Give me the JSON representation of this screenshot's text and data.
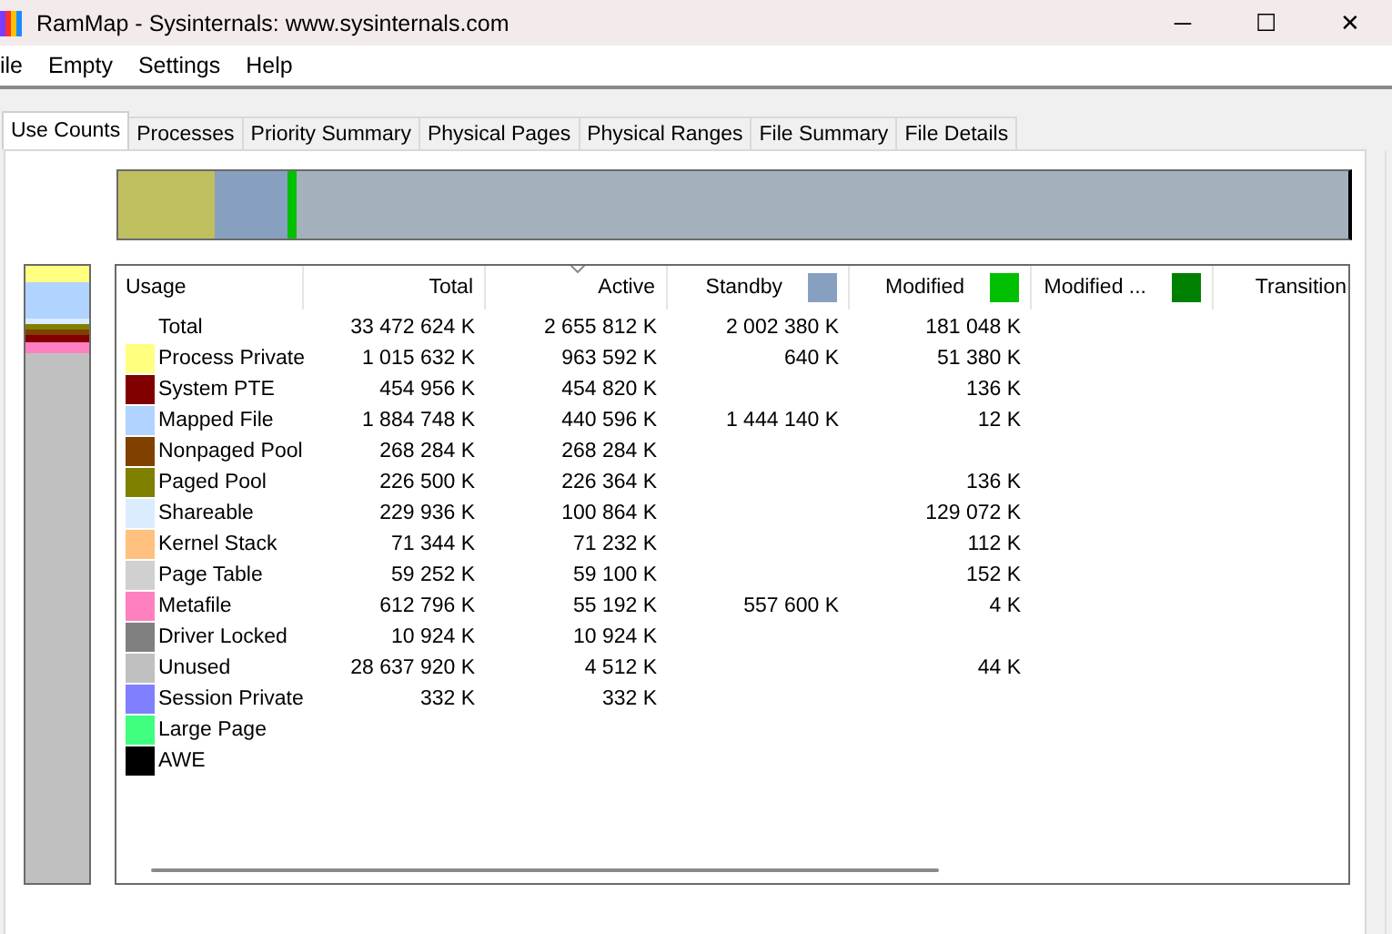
{
  "window": {
    "title": "RamMap - Sysinternals: www.sysinternals.com",
    "controls": [
      "─",
      "☐",
      "✕"
    ]
  },
  "menu": [
    "ile",
    "Empty",
    "Settings",
    "Help"
  ],
  "tabs": [
    {
      "label": "Use Counts",
      "selected": true
    },
    {
      "label": "Processes",
      "selected": false
    },
    {
      "label": "Priority Summary",
      "selected": false
    },
    {
      "label": "Physical Pages",
      "selected": false
    },
    {
      "label": "Physical Ranges",
      "selected": false
    },
    {
      "label": "File Summary",
      "selected": false
    },
    {
      "label": "File Details",
      "selected": false
    }
  ],
  "table": {
    "columns": [
      {
        "label": "Usage",
        "sorted": false
      },
      {
        "label": "Total",
        "sorted": false
      },
      {
        "label": "Active",
        "sorted": true
      },
      {
        "label": "Standby",
        "color": "#87a0c0",
        "sorted": false
      },
      {
        "label": "Modified",
        "color": "#00c000",
        "sorted": false
      },
      {
        "label": "Modified ...",
        "color": "#008000",
        "sorted": false
      },
      {
        "label": "Transition",
        "sorted": false
      }
    ],
    "rows": [
      {
        "cells": [
          "Total",
          "33 472 624 K",
          "2 655 812 K",
          "2 002 380 K",
          "181 048 K"
        ]
      },
      {
        "color": "#ffff80",
        "cells": [
          "Process Private",
          "1 015 632 K",
          "963 592 K",
          "640 K",
          "51 380 K"
        ]
      },
      {
        "color": "#800000",
        "cells": [
          "System PTE",
          "454 956 K",
          "454 820 K",
          "",
          "136 K"
        ]
      },
      {
        "color": "#b0d4ff",
        "cells": [
          "Mapped File",
          "1 884 748 K",
          "440 596 K",
          "1 444 140 K",
          "12 K"
        ]
      },
      {
        "color": "#804000",
        "cells": [
          "Nonpaged Pool",
          "268 284 K",
          "268 284 K"
        ]
      },
      {
        "color": "#808000",
        "cells": [
          "Paged Pool",
          "226 500 K",
          "226 364 K",
          "",
          "136 K"
        ]
      },
      {
        "color": "#dcecff",
        "cells": [
          "Shareable",
          "229 936 K",
          "100 864 K",
          "",
          "129 072 K"
        ]
      },
      {
        "color": "#ffc080",
        "cells": [
          "Kernel Stack",
          "71 344 K",
          "71 232 K",
          "",
          "112 K"
        ]
      },
      {
        "color": "#d0d0d0",
        "cells": [
          "Page Table",
          "59 252 K",
          "59 100 K",
          "",
          "152 K"
        ]
      },
      {
        "color": "#ff80c0",
        "cells": [
          "Metafile",
          "612 796 K",
          "55 192 K",
          "557 600 K",
          "4 K"
        ]
      },
      {
        "color": "#808080",
        "cells": [
          "Driver Locked",
          "10 924 K",
          "10 924 K"
        ]
      },
      {
        "color": "#c0c0c0",
        "cells": [
          "Unused",
          "28 637 920 K",
          "4 512 K",
          "",
          "44 K"
        ]
      },
      {
        "color": "#8080ff",
        "cells": [
          "Session Private",
          "332 K",
          "332 K"
        ]
      },
      {
        "color": "#40ff80",
        "cells": [
          "Large Page"
        ]
      },
      {
        "color": "#000000",
        "cells": [
          "AWE"
        ]
      }
    ]
  }
}
